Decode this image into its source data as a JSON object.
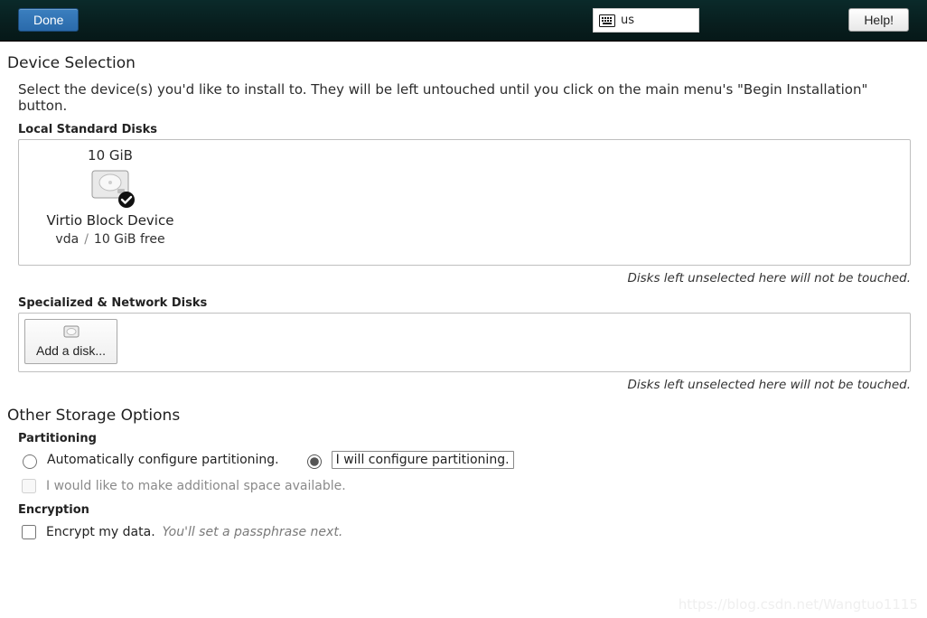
{
  "topbar": {
    "done_label": "Done",
    "help_label": "Help!",
    "keyboard_layout": "us"
  },
  "page": {
    "title": "Device Selection",
    "description": "Select the device(s) you'd like to install to.  They will be left untouched until you click on the main menu's \"Begin Installation\" button."
  },
  "local_disks": {
    "heading": "Local Standard Disks",
    "note": "Disks left unselected here will not be touched.",
    "items": [
      {
        "size": "10 GiB",
        "name": "Virtio Block Device",
        "dev": "vda",
        "free": "10 GiB free",
        "selected": true
      }
    ]
  },
  "network_disks": {
    "heading": "Specialized & Network Disks",
    "add_label": "Add a disk...",
    "note": "Disks left unselected here will not be touched."
  },
  "other": {
    "title": "Other Storage Options",
    "partitioning": {
      "heading": "Partitioning",
      "auto_label": "Automatically configure partitioning.",
      "manual_label": "I will configure partitioning.",
      "selected": "manual",
      "reclaim_label": "I would like to make additional space available."
    },
    "encryption": {
      "heading": "Encryption",
      "label": "Encrypt my data.",
      "hint": "You'll set a passphrase next."
    }
  },
  "watermark": "https://blog.csdn.net/Wangtuo1115"
}
